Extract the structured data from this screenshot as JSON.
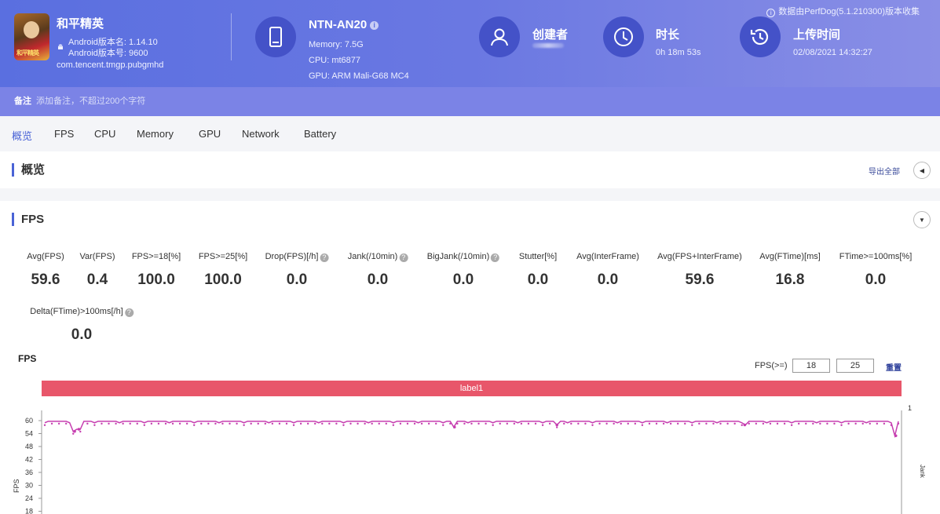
{
  "header": {
    "app": {
      "name": "和平精英",
      "version_name": "Android版本名: 1.14.10",
      "version_code": "Android版本号: 9600",
      "package": "com.tencent.tmgp.pubgmhd",
      "icon_text": "和平精英"
    },
    "device": {
      "model": "NTN-AN20",
      "memory": "Memory: 7.5G",
      "cpu": "CPU: mt6877",
      "gpu": "GPU: ARM Mali-G68 MC4"
    },
    "creator": {
      "label": "创建者"
    },
    "duration": {
      "label": "时长",
      "value": "0h 18m 53s"
    },
    "upload": {
      "label": "上传时间",
      "value": "02/08/2021 14:32:27"
    },
    "data_source": "数据由PerfDog(5.1.210300)版本收集"
  },
  "remark": {
    "label": "备注",
    "placeholder": "添加备注，不超过200个字符"
  },
  "tabs": [
    "概览",
    "FPS",
    "CPU",
    "Memory",
    "GPU",
    "Network",
    "Battery"
  ],
  "overview": {
    "title": "概览",
    "export_label": "导出全部"
  },
  "fps_section": {
    "title": "FPS",
    "metrics": [
      {
        "label": "Avg(FPS)",
        "value": "59.6",
        "help": false
      },
      {
        "label": "Var(FPS)",
        "value": "0.4",
        "help": false
      },
      {
        "label": "FPS>=18[%]",
        "value": "100.0",
        "help": false
      },
      {
        "label": "FPS>=25[%]",
        "value": "100.0",
        "help": false
      },
      {
        "label": "Drop(FPS)[/h]",
        "value": "0.0",
        "help": true
      },
      {
        "label": "Jank(/10min)",
        "value": "0.0",
        "help": true
      },
      {
        "label": "BigJank(/10min)",
        "value": "0.0",
        "help": true
      },
      {
        "label": "Stutter[%]",
        "value": "0.0",
        "help": false
      },
      {
        "label": "Avg(InterFrame)",
        "value": "0.0",
        "help": false
      },
      {
        "label": "Avg(FPS+InterFrame)",
        "value": "59.6",
        "help": false
      },
      {
        "label": "Avg(FTime)[ms]",
        "value": "16.8",
        "help": false
      },
      {
        "label": "FTime>=100ms[%]",
        "value": "0.0",
        "help": false
      },
      {
        "label": "Delta(FTime)>100ms[/h]",
        "value": "0.0",
        "help": true
      }
    ],
    "chart_title": "FPS",
    "threshold_label": "FPS(>=)",
    "threshold_1": "18",
    "threshold_2": "25",
    "reset_label": "重置",
    "label_bar": "label1"
  },
  "chart_data": {
    "type": "line",
    "title": "FPS",
    "ylabel": "FPS",
    "right_axis_top": "1",
    "right_axis_label": "Jank",
    "yticks": [
      60,
      54,
      48,
      42,
      36,
      30,
      24,
      18
    ],
    "ylim": [
      18,
      60
    ],
    "series": [
      {
        "name": "FPS",
        "color": "#c63fb0",
        "baseline": 59.6,
        "dips": [
          {
            "t": 0.035,
            "v": 55
          },
          {
            "t": 0.04,
            "v": 56
          },
          {
            "t": 0.48,
            "v": 57
          },
          {
            "t": 0.6,
            "v": 58
          },
          {
            "t": 0.82,
            "v": 58
          },
          {
            "t": 0.997,
            "v": 53
          }
        ]
      }
    ]
  }
}
